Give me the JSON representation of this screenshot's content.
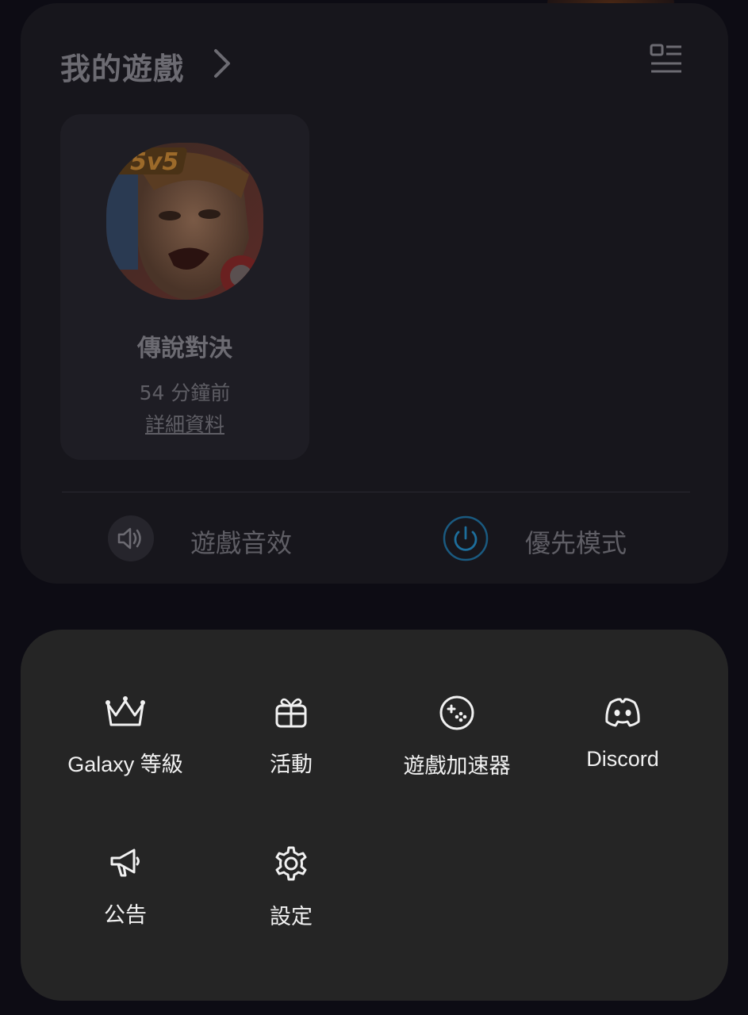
{
  "my_games": {
    "title": "我的遊戲",
    "game": {
      "name": "傳說對決",
      "last_played": "54 分鐘前",
      "details_link": "詳細資料"
    },
    "toggles": {
      "sound_label": "遊戲音效",
      "priority_label": "優先模式"
    }
  },
  "menu": {
    "items": [
      {
        "label": "Galaxy 等級",
        "icon": "crown-icon"
      },
      {
        "label": "活動",
        "icon": "gift-icon"
      },
      {
        "label": "遊戲加速器",
        "icon": "gamepad-icon"
      },
      {
        "label": "Discord",
        "icon": "discord-icon"
      },
      {
        "label": "公告",
        "icon": "megaphone-icon"
      },
      {
        "label": "設定",
        "icon": "gear-icon"
      }
    ]
  },
  "colors": {
    "panel": "#252525",
    "text": "#f1f1f1",
    "accent": "#1d8bc9"
  }
}
